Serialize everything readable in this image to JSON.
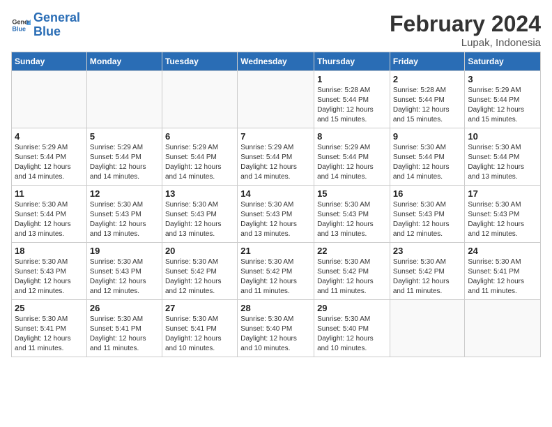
{
  "header": {
    "logo_line1": "General",
    "logo_line2": "Blue",
    "month_year": "February 2024",
    "location": "Lupak, Indonesia"
  },
  "weekdays": [
    "Sunday",
    "Monday",
    "Tuesday",
    "Wednesday",
    "Thursday",
    "Friday",
    "Saturday"
  ],
  "weeks": [
    [
      {
        "day": "",
        "info": ""
      },
      {
        "day": "",
        "info": ""
      },
      {
        "day": "",
        "info": ""
      },
      {
        "day": "",
        "info": ""
      },
      {
        "day": "1",
        "info": "Sunrise: 5:28 AM\nSunset: 5:44 PM\nDaylight: 12 hours\nand 15 minutes."
      },
      {
        "day": "2",
        "info": "Sunrise: 5:28 AM\nSunset: 5:44 PM\nDaylight: 12 hours\nand 15 minutes."
      },
      {
        "day": "3",
        "info": "Sunrise: 5:29 AM\nSunset: 5:44 PM\nDaylight: 12 hours\nand 15 minutes."
      }
    ],
    [
      {
        "day": "4",
        "info": "Sunrise: 5:29 AM\nSunset: 5:44 PM\nDaylight: 12 hours\nand 14 minutes."
      },
      {
        "day": "5",
        "info": "Sunrise: 5:29 AM\nSunset: 5:44 PM\nDaylight: 12 hours\nand 14 minutes."
      },
      {
        "day": "6",
        "info": "Sunrise: 5:29 AM\nSunset: 5:44 PM\nDaylight: 12 hours\nand 14 minutes."
      },
      {
        "day": "7",
        "info": "Sunrise: 5:29 AM\nSunset: 5:44 PM\nDaylight: 12 hours\nand 14 minutes."
      },
      {
        "day": "8",
        "info": "Sunrise: 5:29 AM\nSunset: 5:44 PM\nDaylight: 12 hours\nand 14 minutes."
      },
      {
        "day": "9",
        "info": "Sunrise: 5:30 AM\nSunset: 5:44 PM\nDaylight: 12 hours\nand 14 minutes."
      },
      {
        "day": "10",
        "info": "Sunrise: 5:30 AM\nSunset: 5:44 PM\nDaylight: 12 hours\nand 13 minutes."
      }
    ],
    [
      {
        "day": "11",
        "info": "Sunrise: 5:30 AM\nSunset: 5:44 PM\nDaylight: 12 hours\nand 13 minutes."
      },
      {
        "day": "12",
        "info": "Sunrise: 5:30 AM\nSunset: 5:43 PM\nDaylight: 12 hours\nand 13 minutes."
      },
      {
        "day": "13",
        "info": "Sunrise: 5:30 AM\nSunset: 5:43 PM\nDaylight: 12 hours\nand 13 minutes."
      },
      {
        "day": "14",
        "info": "Sunrise: 5:30 AM\nSunset: 5:43 PM\nDaylight: 12 hours\nand 13 minutes."
      },
      {
        "day": "15",
        "info": "Sunrise: 5:30 AM\nSunset: 5:43 PM\nDaylight: 12 hours\nand 13 minutes."
      },
      {
        "day": "16",
        "info": "Sunrise: 5:30 AM\nSunset: 5:43 PM\nDaylight: 12 hours\nand 12 minutes."
      },
      {
        "day": "17",
        "info": "Sunrise: 5:30 AM\nSunset: 5:43 PM\nDaylight: 12 hours\nand 12 minutes."
      }
    ],
    [
      {
        "day": "18",
        "info": "Sunrise: 5:30 AM\nSunset: 5:43 PM\nDaylight: 12 hours\nand 12 minutes."
      },
      {
        "day": "19",
        "info": "Sunrise: 5:30 AM\nSunset: 5:43 PM\nDaylight: 12 hours\nand 12 minutes."
      },
      {
        "day": "20",
        "info": "Sunrise: 5:30 AM\nSunset: 5:42 PM\nDaylight: 12 hours\nand 12 minutes."
      },
      {
        "day": "21",
        "info": "Sunrise: 5:30 AM\nSunset: 5:42 PM\nDaylight: 12 hours\nand 11 minutes."
      },
      {
        "day": "22",
        "info": "Sunrise: 5:30 AM\nSunset: 5:42 PM\nDaylight: 12 hours\nand 11 minutes."
      },
      {
        "day": "23",
        "info": "Sunrise: 5:30 AM\nSunset: 5:42 PM\nDaylight: 12 hours\nand 11 minutes."
      },
      {
        "day": "24",
        "info": "Sunrise: 5:30 AM\nSunset: 5:41 PM\nDaylight: 12 hours\nand 11 minutes."
      }
    ],
    [
      {
        "day": "25",
        "info": "Sunrise: 5:30 AM\nSunset: 5:41 PM\nDaylight: 12 hours\nand 11 minutes."
      },
      {
        "day": "26",
        "info": "Sunrise: 5:30 AM\nSunset: 5:41 PM\nDaylight: 12 hours\nand 11 minutes."
      },
      {
        "day": "27",
        "info": "Sunrise: 5:30 AM\nSunset: 5:41 PM\nDaylight: 12 hours\nand 10 minutes."
      },
      {
        "day": "28",
        "info": "Sunrise: 5:30 AM\nSunset: 5:40 PM\nDaylight: 12 hours\nand 10 minutes."
      },
      {
        "day": "29",
        "info": "Sunrise: 5:30 AM\nSunset: 5:40 PM\nDaylight: 12 hours\nand 10 minutes."
      },
      {
        "day": "",
        "info": ""
      },
      {
        "day": "",
        "info": ""
      }
    ]
  ]
}
